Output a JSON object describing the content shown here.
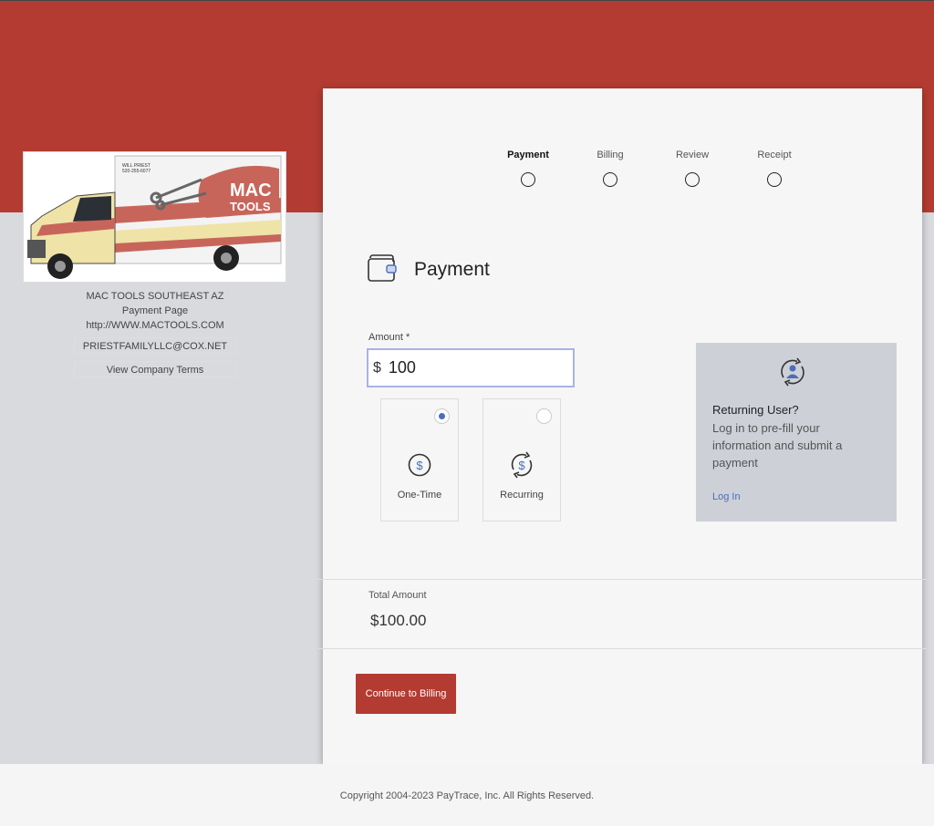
{
  "merchant": {
    "name": "MAC TOOLS SOUTHEAST AZ",
    "page_label": "Payment Page",
    "website": "http://WWW.MACTOOLS.COM",
    "email": "PRIESTFAMILYLLC@COX.NET",
    "terms_link": "View Company Terms",
    "logo": {
      "truck_name": "WILL PRIEST",
      "truck_phone": "520-255-6077",
      "brand_top": "MAC",
      "brand_bottom": "TOOLS"
    }
  },
  "steps": [
    {
      "label": "Payment",
      "active": true
    },
    {
      "label": "Billing",
      "active": false
    },
    {
      "label": "Review",
      "active": false
    },
    {
      "label": "Receipt",
      "active": false
    }
  ],
  "payment": {
    "title": "Payment",
    "amount_label": "Amount",
    "required_mark": "*",
    "currency_symbol": "$",
    "amount_value": "100",
    "options": [
      {
        "label": "One-Time",
        "selected": true,
        "icon": "dollar-circle-icon"
      },
      {
        "label": "Recurring",
        "selected": false,
        "icon": "recurring-dollar-icon"
      }
    ]
  },
  "returning_user": {
    "title": "Returning User?",
    "body": "Log in to pre-fill your information and submit a payment",
    "link": "Log In"
  },
  "total": {
    "label": "Total Amount",
    "value": "$100.00"
  },
  "cta": {
    "label": "Continue to Billing"
  },
  "footer": {
    "copyright": "Copyright 2004-2023 PayTrace, Inc. All Rights Reserved."
  },
  "colors": {
    "brand_red": "#b43b31",
    "link_blue": "#4a6fb5",
    "focus_border": "#a9b2e6"
  }
}
